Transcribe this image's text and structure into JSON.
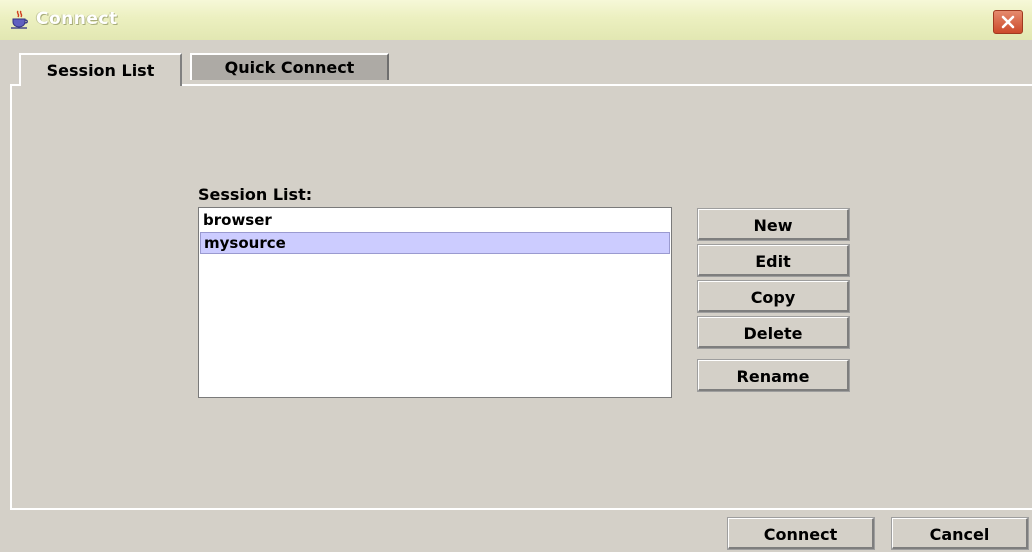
{
  "window": {
    "title": "Connect"
  },
  "tabs": [
    {
      "label": "Session List",
      "active": true
    },
    {
      "label": "Quick Connect",
      "active": false
    }
  ],
  "session_list": {
    "label": "Session List:",
    "items": [
      {
        "label": "browser",
        "selected": false
      },
      {
        "label": "mysource",
        "selected": true
      }
    ]
  },
  "actions": {
    "new_label": "New",
    "edit_label": "Edit",
    "copy_label": "Copy",
    "delete_label": "Delete",
    "rename_label": "Rename"
  },
  "footer": {
    "connect_label": "Connect",
    "cancel_label": "Cancel"
  },
  "colors": {
    "window_bg": "#d4d0c8",
    "selection_bg": "#ccccff",
    "close_button": "#d65a3a"
  },
  "icons": {
    "app": "java-coffee-cup-icon",
    "close": "close-icon"
  }
}
